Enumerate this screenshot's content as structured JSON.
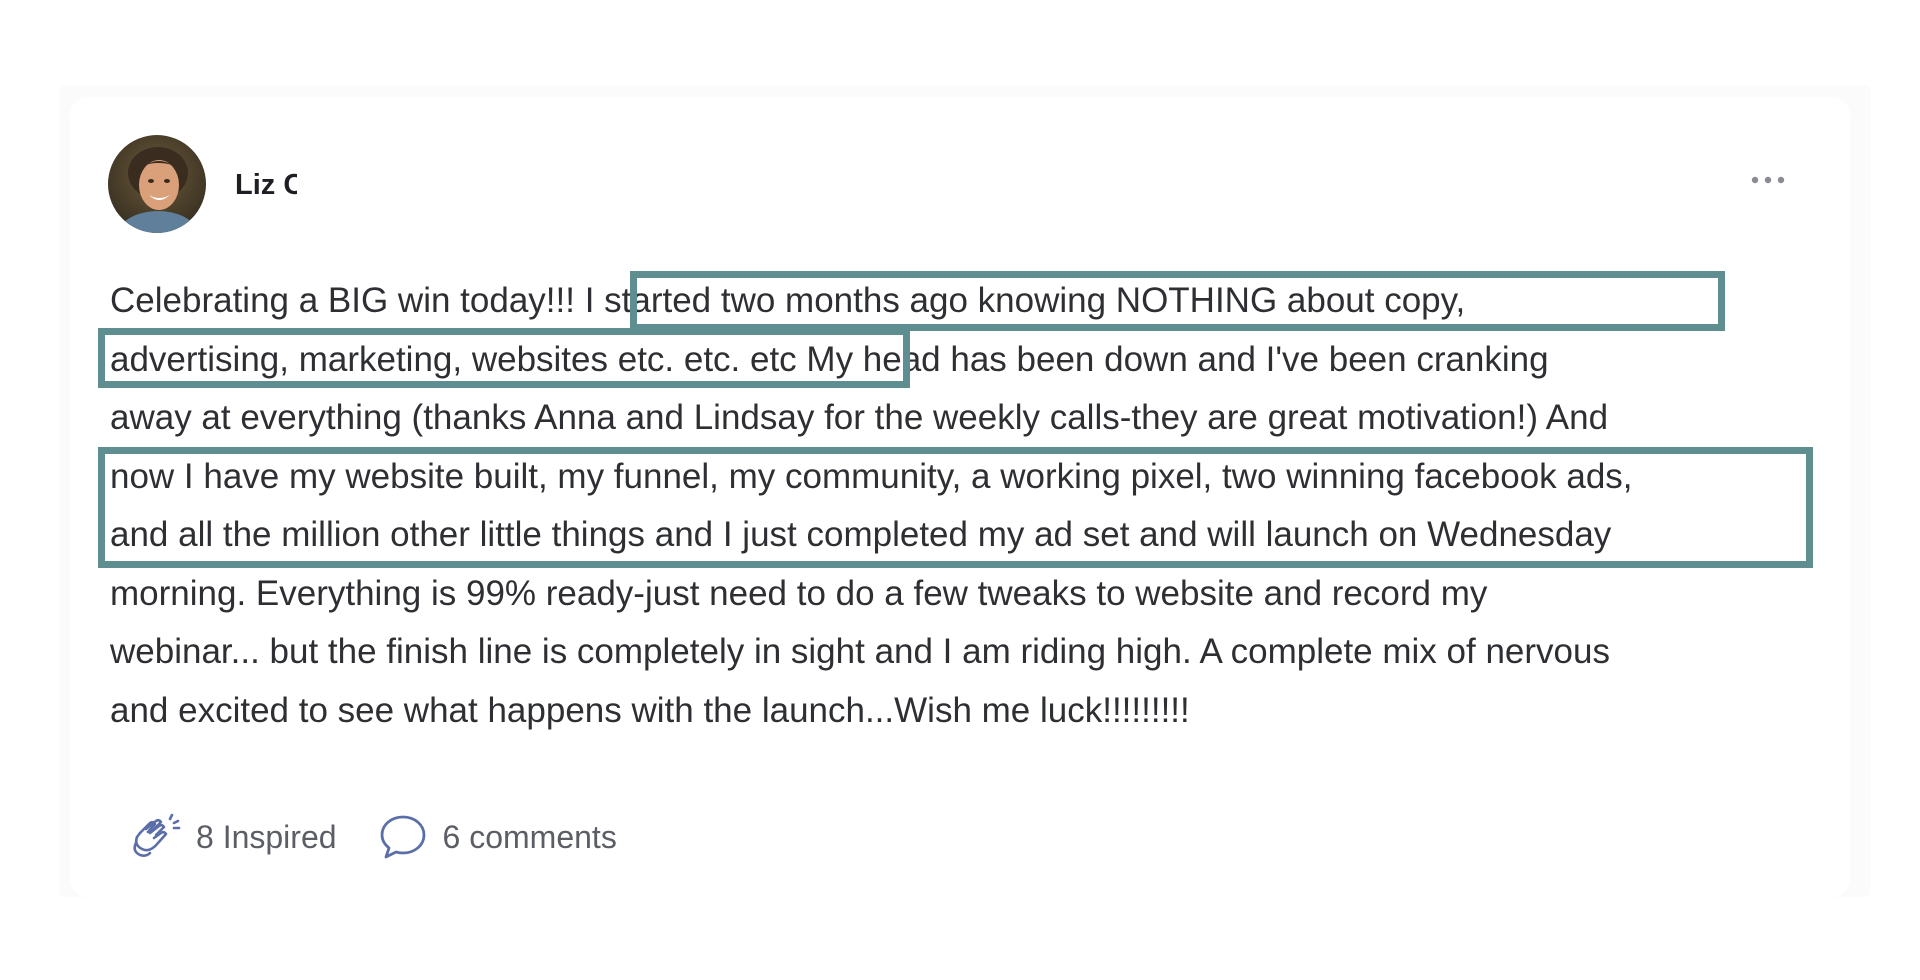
{
  "post": {
    "author_name": "Liz C",
    "more_icon": "more-horizontal-icon",
    "body_lines": [
      "Celebrating a BIG win today!!! I started two months ago knowing NOTHING about copy,",
      "advertising, marketing, websites etc. etc. etc My head has been down and I've been cranking",
      "away at everything (thanks Anna and Lindsay for the weekly calls-they are great motivation!) And",
      "now I have my website built, my funnel, my community, a working pixel, two winning facebook ads,",
      "and all the million other little things and I just completed my ad set and will launch on Wednesday",
      "morning. Everything is 99% ready-just need to do a few tweaks to website and record my",
      "webinar... but the finish line is completely in sight and I am riding high. A complete mix of nervous",
      "and excited to see what happens with the launch...Wish me luck!!!!!!!!!"
    ],
    "inspired_label": "8 Inspired",
    "comments_label": "6 comments"
  },
  "colors": {
    "highlight_border": "#5e8e8f",
    "action_icon": "#5b6ea8",
    "text": "#2e2f33"
  },
  "icons": {
    "inspired": "clapping-hands-icon",
    "comments": "speech-bubble-icon"
  }
}
